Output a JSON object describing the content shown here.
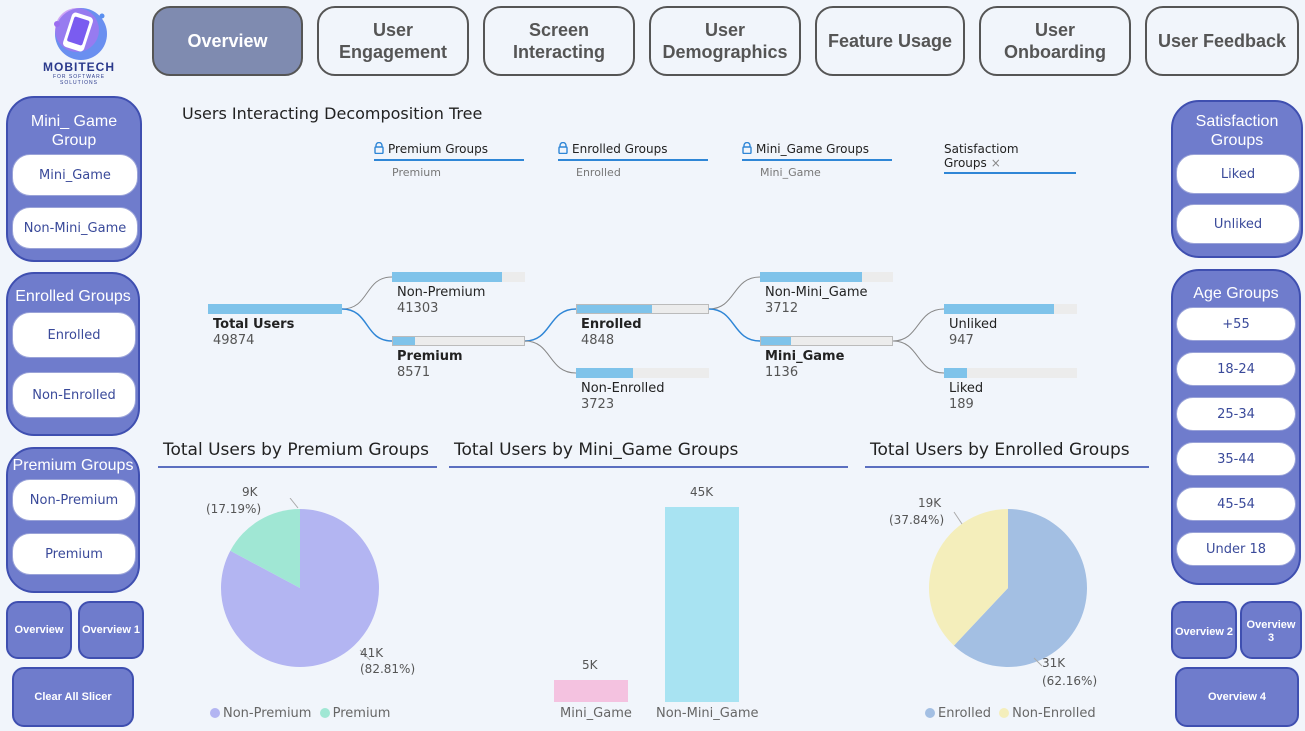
{
  "logo": {
    "brand": "MOBITECH",
    "tagline": "FOR SOFTWARE SOLUTIONS"
  },
  "nav": [
    {
      "label": "Overview",
      "active": true
    },
    {
      "label": "User Engagement"
    },
    {
      "label": "Screen Interacting"
    },
    {
      "label": "User Demographics"
    },
    {
      "label": "Feature Usage"
    },
    {
      "label": "User Onboarding"
    },
    {
      "label": "User Feedback"
    }
  ],
  "left_slicers": {
    "mini_game": {
      "title": "Mini_ Game Group",
      "items": [
        "Mini_Game",
        "Non-Mini_Game"
      ]
    },
    "enrolled": {
      "title": "Enrolled Groups",
      "items": [
        "Enrolled",
        "Non-Enrolled"
      ]
    },
    "premium": {
      "title": "Premium Groups",
      "items": [
        "Non-Premium",
        "Premium"
      ]
    },
    "buttons": {
      "overview": "Overview",
      "overview1": "Overview 1",
      "clear": "Clear All Slicer"
    }
  },
  "right_slicers": {
    "satisfaction": {
      "title": "Satisfaction Groups",
      "items": [
        "Liked",
        "Unliked"
      ]
    },
    "age": {
      "title": "Age Groups",
      "items": [
        "+55",
        "18-24",
        "25-34",
        "35-44",
        "45-54",
        "Under 18"
      ]
    },
    "buttons": {
      "overview2": "Overview 2",
      "overview3": "Overview 3",
      "overview4": "Overview 4"
    }
  },
  "tree": {
    "title": "Users Interacting Decomposition Tree",
    "levels": [
      {
        "name": "Premium Groups",
        "sub": "Premium",
        "locked": true
      },
      {
        "name": "Enrolled Groups",
        "sub": "Enrolled",
        "locked": true
      },
      {
        "name": "Mini_Game Groups",
        "sub": "Mini_Game",
        "locked": true
      },
      {
        "name": "Satisfactiom Groups",
        "sub": "",
        "locked": false
      }
    ],
    "close_icon": "×",
    "root": {
      "label": "Total Users",
      "value": "49874",
      "share": 1.0
    },
    "premium_nodes": [
      {
        "label": "Non-Premium",
        "value": "41303",
        "share": 0.83
      },
      {
        "label": "Premium",
        "value": "8571",
        "share": 0.17
      }
    ],
    "enrolled_nodes": [
      {
        "label": "Enrolled",
        "value": "4848",
        "share": 0.57
      },
      {
        "label": "Non-Enrolled",
        "value": "3723",
        "share": 0.43
      }
    ],
    "mini_nodes": [
      {
        "label": "Non-Mini_Game",
        "value": "3712",
        "share": 0.77
      },
      {
        "label": "Mini_Game",
        "value": "1136",
        "share": 0.23
      }
    ],
    "satisfaction_nodes": [
      {
        "label": "Unliked",
        "value": "947",
        "share": 0.83
      },
      {
        "label": "Liked",
        "value": "189",
        "share": 0.17
      }
    ]
  },
  "chart_data": [
    {
      "type": "pie",
      "title": "Total Users by Premium Groups",
      "categories": [
        "Non-Premium",
        "Premium"
      ],
      "values": [
        41303,
        8571
      ],
      "percents": [
        82.81,
        17.19
      ],
      "labels": [
        "41K",
        "9K"
      ],
      "pct_labels": [
        "(82.81%)",
        "(17.19%)"
      ],
      "colors": [
        "#b3b5f2",
        "#a0e7d4"
      ],
      "legend": "bottom"
    },
    {
      "type": "bar",
      "title": "Total Users by Mini_Game Groups",
      "categories": [
        "Mini_Game",
        "Non-Mini_Game"
      ],
      "values": [
        5,
        45
      ],
      "labels": [
        "5K",
        "45K"
      ],
      "colors": [
        "#f4c2e0",
        "#a8e3f2"
      ]
    },
    {
      "type": "pie",
      "title": "Total Users by Enrolled Groups",
      "categories": [
        "Enrolled",
        "Non-Enrolled"
      ],
      "values": [
        31,
        19
      ],
      "percents": [
        62.16,
        37.84
      ],
      "labels": [
        "31K",
        "19K"
      ],
      "pct_labels": [
        "(62.16%)",
        "(37.84%)"
      ],
      "colors": [
        "#a3bfe3",
        "#f4eebb"
      ],
      "legend": "bottom"
    }
  ]
}
